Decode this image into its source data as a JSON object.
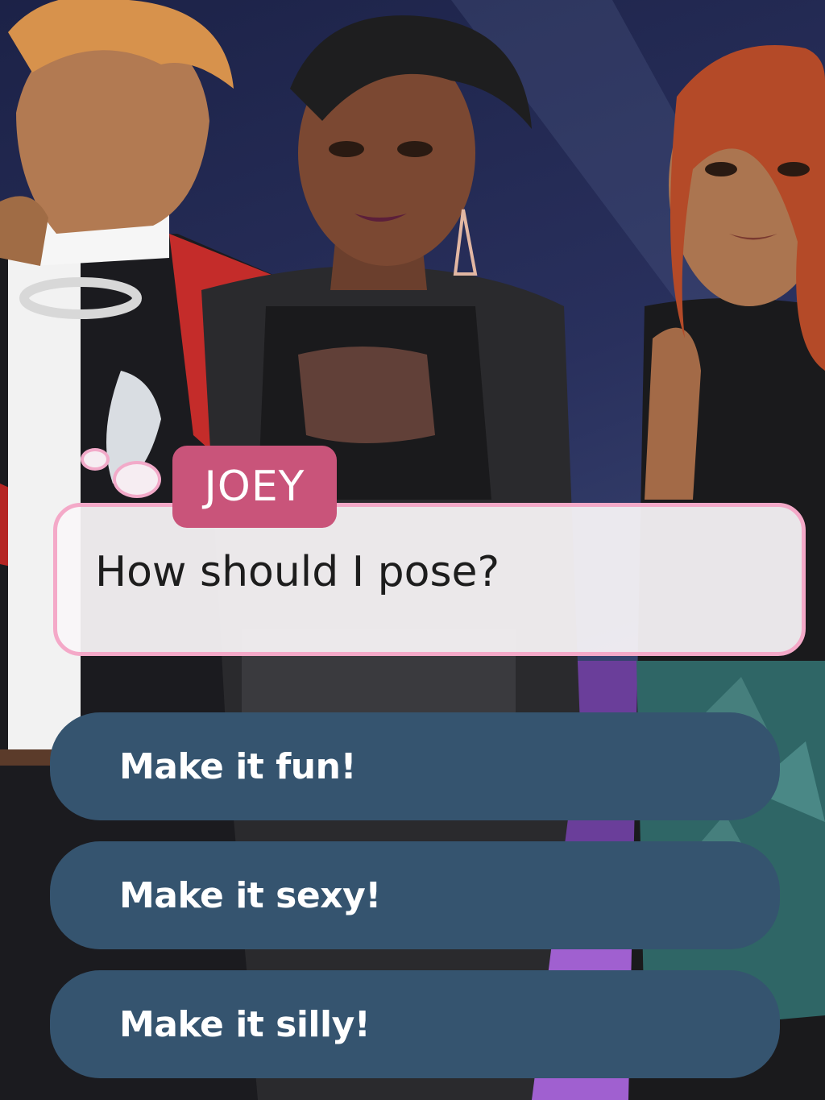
{
  "dialogue": {
    "speaker": "JOEY",
    "line": "How should I pose?"
  },
  "choices": [
    {
      "label": "Make it fun!"
    },
    {
      "label": "Make it sexy!"
    },
    {
      "label": "Make it silly!"
    }
  ],
  "colors": {
    "name_tag": "#c9547a",
    "bubble_border": "#f4a9c8",
    "choice_button": "#35546f",
    "background": "#29305d"
  }
}
